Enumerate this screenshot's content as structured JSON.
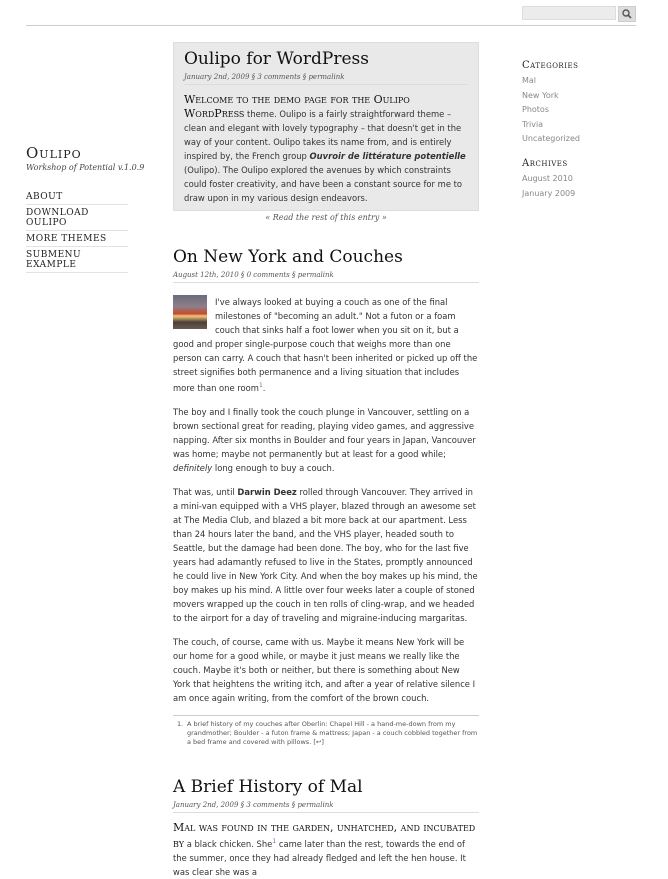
{
  "search": {
    "placeholder": "",
    "icon": "search-icon"
  },
  "site": {
    "title": "Oulipo",
    "tagline": "Workshop of Potential v.1.0.9"
  },
  "nav": {
    "items": [
      "About",
      "Download Oulipo",
      "More Themes",
      "Submenu Example"
    ]
  },
  "categories": {
    "heading": "Categories",
    "items": [
      "Mal",
      "New York",
      "Photos",
      "Trivia",
      "Uncategorized"
    ]
  },
  "archives": {
    "heading": "Archives",
    "items": [
      "August 2010",
      "January 2009"
    ]
  },
  "featured": {
    "title": "Oulipo for WordPress",
    "meta": "January 2nd, 2009 § 3 comments § permalink",
    "lead": "Welcome to the demo page for the Oulipo WordPress",
    "text_a": " theme. Oulipo is a fairly straightforward theme – clean and elegant with lovely typography – that doesn't get in the way of your content. Oulipo takes its name from, and is entirely inspired by, the French group ",
    "text_b": "Ouvroir de littérature potentielle",
    "text_c": " (Oulipo). The Oulipo explored the avenues by which constraints could foster creativity, and have been a constant source for me to draw upon in my various design endeavors.",
    "more": "« Read the rest of this entry »"
  },
  "post2": {
    "title": "On New York and Couches",
    "meta": "August 12th, 2010 § 0 comments § permalink",
    "p1": "I've always looked at buying a couch as one of the final milestones of \"becoming an adult.\" Not a futon or a foam couch that sinks half a foot lower when you sit on it, but a good and proper single-purpose couch that weighs more than one person can carry. A couch that hasn't been inherited or picked up off the street signifies both permanence and a living situation that includes more than one room",
    "p1_sup": "1",
    "p1_end": ".",
    "p2a": "The boy and I finally took the couch plunge in Vancouver, settling on a brown sectional great for reading, playing video games, and aggressive napping. After six months in Boulder and four years in Japan, Vancouver was home; maybe not permanently but at least for a good while; ",
    "p2b": "definitely",
    "p2c": " long enough to buy a couch.",
    "p3a": "That was, until ",
    "p3b": "Darwin Deez",
    "p3c": " rolled through Vancouver. They arrived in a mini-van equipped with a VHS player, blazed through an awesome set at The Media Club, and blazed a bit more back at our apartment. Less than 24 hours later the band, and the VHS player, headed south to Seattle, but the damage had been done. The boy, who for the last five years had adamantly refused to live in the States, promptly announced he could live in New York City. And when the boy makes up his mind, the boy makes up his mind. A little over four weeks later a couple of stoned movers wrapped up the couch in ten rolls of cling-wrap, and we headed to the airport for a day of traveling and migraine-inducing margaritas.",
    "p4": "The couch, of course, came with us. Maybe it means New York will be our home for a good while, or maybe it just means we really like the couch. Maybe it's both or neither, but there is something about New York that heightens the writing itch, and after a year of relative silence I am once again writing, from the comfort of the brown couch.",
    "fn_num": "1.",
    "fn": "A brief history of my couches after Oberlin: Chapel Hill - a hand-me-down from my grandmother; Boulder - a futon frame & mattress; Japan - a couch cobbled together from a bed frame and covered with pillows. [↩]"
  },
  "post3": {
    "title": "A Brief History of Mal",
    "meta": "January 2nd, 2009 § 3 comments § permalink",
    "lead": "Mal was found in the garden, unhatched, and incubated by",
    "text_a": " a black chicken. She",
    "sup": "1",
    "text_b": " came later than the rest, towards the end of the summer, once they had already fledged and left the hen house. It was clear she was a"
  }
}
